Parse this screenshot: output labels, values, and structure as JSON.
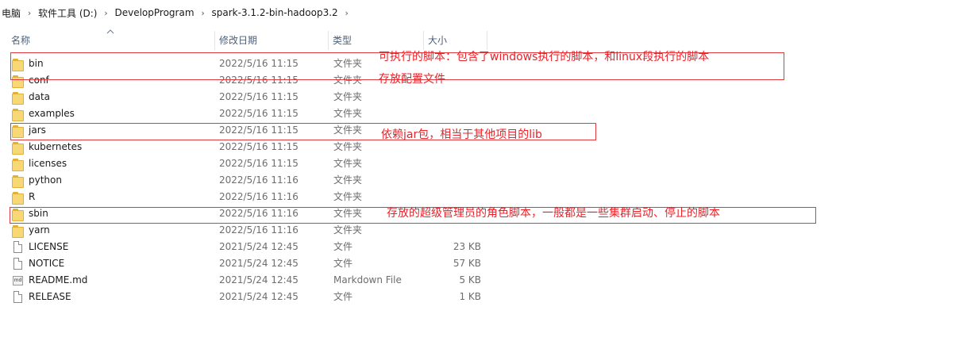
{
  "breadcrumb": {
    "items": [
      "电脑",
      "软件工具 (D:)",
      "DevelopProgram",
      "spark-3.1.2-bin-hadoop3.2"
    ],
    "separator": "›"
  },
  "columns": {
    "name": "名称",
    "date": "修改日期",
    "type": "类型",
    "size": "大小"
  },
  "files": [
    {
      "name": "bin",
      "date": "2022/5/16 11:15",
      "type": "文件夹",
      "size": "",
      "icon": "folder-icon"
    },
    {
      "name": "conf",
      "date": "2022/5/16 11:15",
      "type": "文件夹",
      "size": "",
      "icon": "folder-icon"
    },
    {
      "name": "data",
      "date": "2022/5/16 11:15",
      "type": "文件夹",
      "size": "",
      "icon": "folder-icon"
    },
    {
      "name": "examples",
      "date": "2022/5/16 11:15",
      "type": "文件夹",
      "size": "",
      "icon": "folder-icon"
    },
    {
      "name": "jars",
      "date": "2022/5/16 11:15",
      "type": "文件夹",
      "size": "",
      "icon": "folder-icon"
    },
    {
      "name": "kubernetes",
      "date": "2022/5/16 11:15",
      "type": "文件夹",
      "size": "",
      "icon": "folder-icon"
    },
    {
      "name": "licenses",
      "date": "2022/5/16 11:15",
      "type": "文件夹",
      "size": "",
      "icon": "folder-icon"
    },
    {
      "name": "python",
      "date": "2022/5/16 11:16",
      "type": "文件夹",
      "size": "",
      "icon": "folder-icon"
    },
    {
      "name": "R",
      "date": "2022/5/16 11:16",
      "type": "文件夹",
      "size": "",
      "icon": "folder-icon"
    },
    {
      "name": "sbin",
      "date": "2022/5/16 11:16",
      "type": "文件夹",
      "size": "",
      "icon": "folder-icon"
    },
    {
      "name": "yarn",
      "date": "2022/5/16 11:16",
      "type": "文件夹",
      "size": "",
      "icon": "folder-icon"
    },
    {
      "name": "LICENSE",
      "date": "2021/5/24 12:45",
      "type": "文件",
      "size": "23 KB",
      "icon": "file-icon"
    },
    {
      "name": "NOTICE",
      "date": "2021/5/24 12:45",
      "type": "文件",
      "size": "57 KB",
      "icon": "file-icon"
    },
    {
      "name": "README.md",
      "date": "2021/5/24 12:45",
      "type": "Markdown File",
      "size": "5 KB",
      "icon": "markdown-file-icon"
    },
    {
      "name": "RELEASE",
      "date": "2021/5/24 12:45",
      "type": "文件",
      "size": "1 KB",
      "icon": "file-icon"
    }
  ],
  "annotations": {
    "bin_note_1": "可执行的脚本：包含了windows执行的脚本，和linux段执行的脚本",
    "conf_note": "存放配置文件",
    "jars_note": "依赖jar包，相当于其他项目的lib",
    "sbin_note": "存放的超级管理员的角色脚本，一般都是一些集群启动、停止的脚本"
  },
  "colors": {
    "annotation": "#e8232a",
    "folder": "#f8d775",
    "header_text": "#4c607a"
  }
}
